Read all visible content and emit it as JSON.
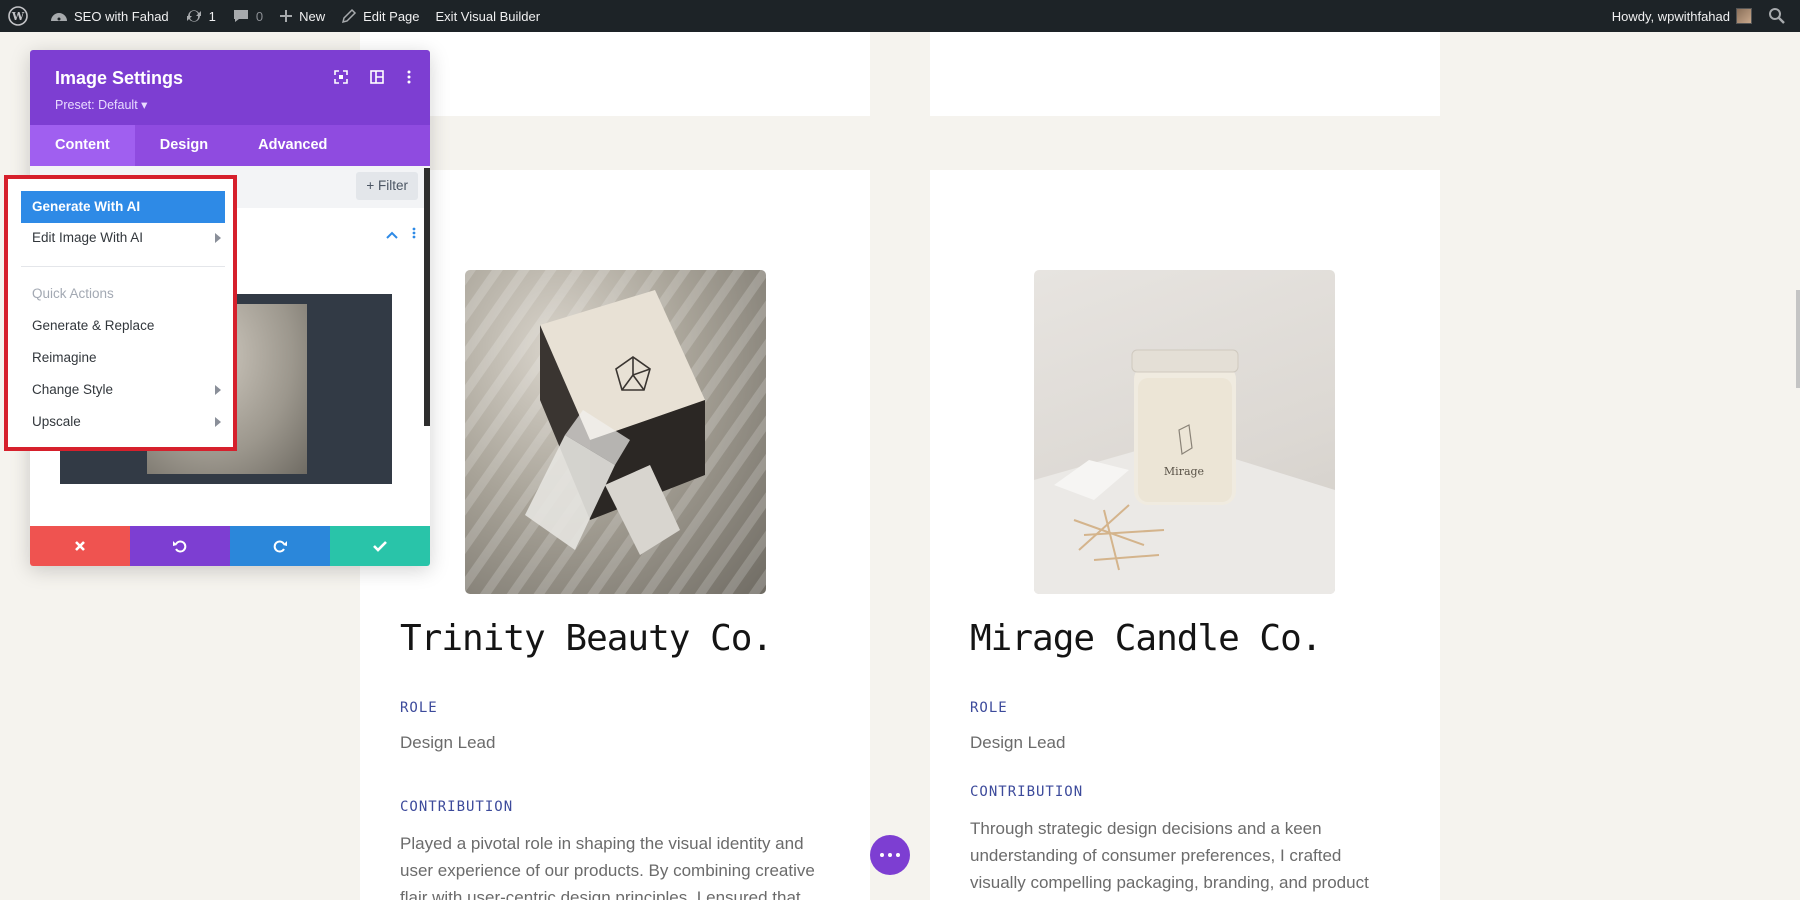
{
  "admin_bar": {
    "site_name": "SEO with Fahad",
    "updates_count": "1",
    "comments_count": "0",
    "new_label": "New",
    "edit_page_label": "Edit Page",
    "exit_builder_label": "Exit Visual Builder",
    "howdy_label": "Howdy, wpwithfahad"
  },
  "panel": {
    "title": "Image Settings",
    "preset": "Preset: Default",
    "tabs": [
      "Content",
      "Design",
      "Advanced"
    ],
    "filter_label": "Filter"
  },
  "dropdown": {
    "primary": "Generate With AI",
    "edit": "Edit Image With AI",
    "section_header": "Quick Actions",
    "items": [
      "Generate & Replace",
      "Reimagine",
      "Change Style",
      "Upscale"
    ]
  },
  "cards": [
    {
      "title": "Trinity Beauty Co.",
      "role_label": "ROLE",
      "role": "Design Lead",
      "contribution_label": "CONTRIBUTION",
      "text": "Played a pivotal role in shaping the visual identity and user experience of our products. By combining creative flair with user-centric design principles, I ensured that"
    },
    {
      "title": "Mirage Candle Co.",
      "role_label": "ROLE",
      "role": "Design Lead",
      "contribution_label": "CONTRIBUTION",
      "text": "Through strategic design decisions and a keen understanding of consumer preferences, I crafted visually compelling packaging, branding, and product",
      "jar_brand": "Mirage"
    }
  ],
  "colors": {
    "panel_purple": "#7d3ed2",
    "highlight_blue": "#2e8ae6",
    "cancel_red": "#ef5350",
    "save_green": "#29c4a9",
    "redo_blue": "#2b87da"
  }
}
